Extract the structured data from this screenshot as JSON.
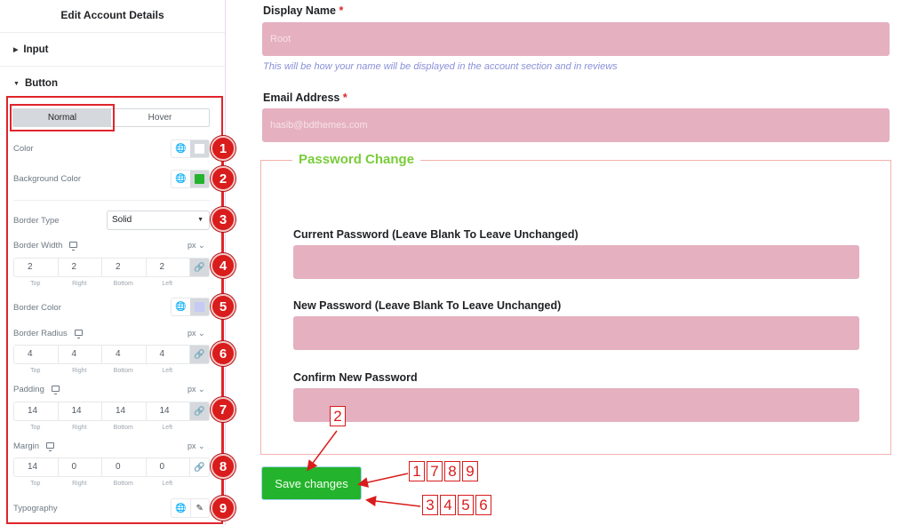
{
  "panel": {
    "title": "Edit Account Details",
    "sections": [
      {
        "label": "Input",
        "expanded": false
      },
      {
        "label": "Button",
        "expanded": true
      }
    ],
    "tabs": [
      {
        "label": "Normal",
        "active": true
      },
      {
        "label": "Hover",
        "active": false
      }
    ],
    "controls": {
      "color": {
        "label": "Color",
        "swatch": "#ffffff"
      },
      "background_color": {
        "label": "Background Color",
        "swatch": "#24b32c"
      },
      "border_type": {
        "label": "Border Type",
        "value": "Solid"
      },
      "border_width": {
        "label": "Border Width",
        "unit": "px",
        "values": [
          "2",
          "2",
          "2",
          "2"
        ],
        "linked": true
      },
      "border_color": {
        "label": "Border Color",
        "swatch": "#c5cbf5"
      },
      "border_radius": {
        "label": "Border Radius",
        "unit": "px",
        "values": [
          "4",
          "4",
          "4",
          "4"
        ],
        "linked": true
      },
      "padding": {
        "label": "Padding",
        "unit": "px",
        "values": [
          "14",
          "14",
          "14",
          "14"
        ],
        "linked": true
      },
      "margin": {
        "label": "Margin",
        "unit": "px",
        "values": [
          "14",
          "0",
          "0",
          "0"
        ],
        "linked": false
      },
      "typography": {
        "label": "Typography"
      }
    },
    "dim_labels": [
      "Top",
      "Right",
      "Bottom",
      "Left"
    ],
    "badges": [
      "1",
      "2",
      "3",
      "4",
      "5",
      "6",
      "7",
      "8",
      "9"
    ]
  },
  "form": {
    "display_name": {
      "label": "Display Name",
      "required_mark": "*",
      "value": "Root",
      "hint": "This will be how your name will be displayed in the account section and in reviews"
    },
    "email": {
      "label": "Email Address",
      "required_mark": "*",
      "value": "hasib@bdthemes.com"
    },
    "password_change": {
      "legend": "Password Change",
      "current": {
        "label": "Current Password (Leave Blank To Leave Unchanged)",
        "value": ""
      },
      "new": {
        "label": "New Password (Leave Blank To Leave Unchanged)",
        "value": ""
      },
      "confirm": {
        "label": "Confirm New Password",
        "value": ""
      }
    },
    "save_button": "Save changes"
  },
  "annotations": {
    "top": [
      "2"
    ],
    "right_upper": [
      "1",
      "7",
      "8",
      "9"
    ],
    "right_lower": [
      "3",
      "4",
      "5",
      "6"
    ]
  },
  "colors": {
    "accent_red": "#d91c1c",
    "input_bg": "#e5b0c0",
    "button_green": "#24b32c",
    "legend_green": "#79cc3a"
  }
}
